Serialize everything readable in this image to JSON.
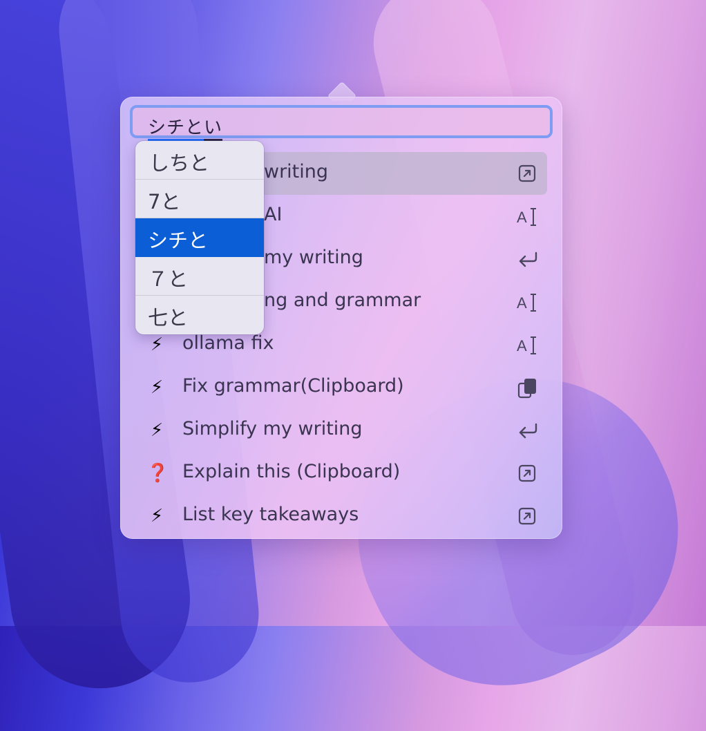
{
  "search": {
    "composing_text": "シチと",
    "remaining_text": "い"
  },
  "items": [
    {
      "emoji": "",
      "label": "writing",
      "action_icon": "open-external-icon"
    },
    {
      "emoji": "",
      "label": "AI",
      "action_icon": "text-cursor-icon"
    },
    {
      "emoji": "",
      "label": "my writing",
      "action_icon": "return-icon"
    },
    {
      "emoji": "",
      "label": "ng and grammar",
      "action_icon": "text-cursor-icon"
    },
    {
      "emoji": "⚡",
      "label": "ollama fix",
      "action_icon": "text-cursor-icon"
    },
    {
      "emoji": "⚡",
      "label": "Fix grammar(Clipboard)",
      "action_icon": "clipboard-icon"
    },
    {
      "emoji": "⚡",
      "label": "Simplify my writing",
      "action_icon": "return-icon"
    },
    {
      "emoji": "❓",
      "label": "Explain this (Clipboard)",
      "action_icon": "open-external-icon"
    },
    {
      "emoji": "⚡",
      "label": "List key takeaways",
      "action_icon": "open-external-icon"
    }
  ],
  "candidates": [
    "しちと",
    "7と",
    "シチと",
    "７と",
    "七と"
  ],
  "selected_candidate": 2,
  "colors": {
    "accent": "#0b5ed6",
    "focus_ring": "#7f9cf3"
  }
}
